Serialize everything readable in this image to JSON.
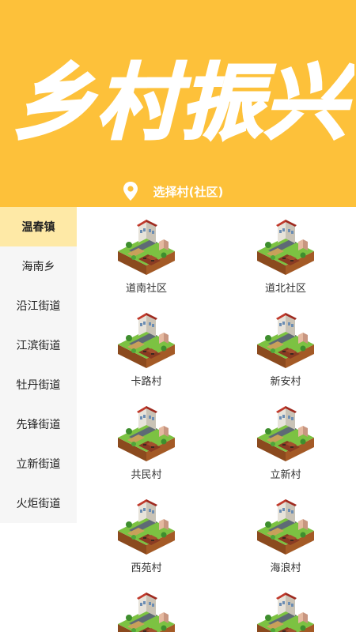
{
  "header": {
    "title": "乡村振兴",
    "location_label": "选择村(社区)"
  },
  "sidebar": {
    "items": [
      {
        "label": "温春镇",
        "active": true
      },
      {
        "label": "海南乡",
        "active": false
      },
      {
        "label": "沿江街道",
        "active": false
      },
      {
        "label": "江滨街道",
        "active": false
      },
      {
        "label": "牡丹街道",
        "active": false
      },
      {
        "label": "先锋街道",
        "active": false
      },
      {
        "label": "立新街道",
        "active": false
      },
      {
        "label": "火炬街道",
        "active": false
      }
    ]
  },
  "villages": [
    {
      "name": "道南社区"
    },
    {
      "name": "道北社区"
    },
    {
      "name": "卡路村"
    },
    {
      "name": "新安村"
    },
    {
      "name": "共民村"
    },
    {
      "name": "立新村"
    },
    {
      "name": "西苑村"
    },
    {
      "name": "海浪村"
    },
    {
      "name": ""
    },
    {
      "name": ""
    }
  ],
  "colors": {
    "banner": "#FDC13A",
    "active_item": "#FEE9A6",
    "sidebar_bg": "#F6F6F6"
  }
}
